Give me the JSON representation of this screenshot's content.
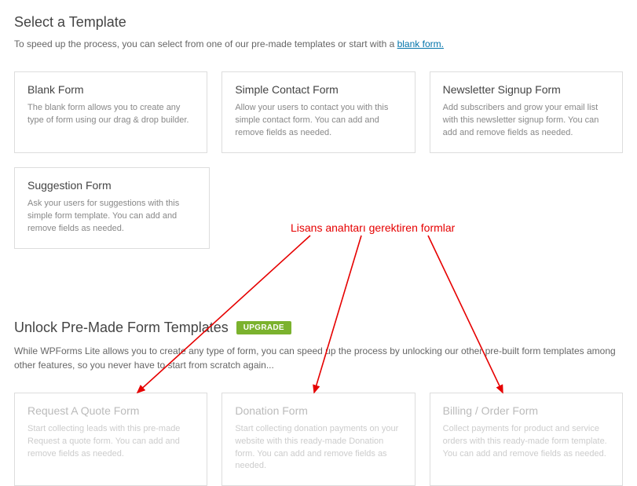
{
  "header": {
    "title": "Select a Template",
    "desc_prefix": "To speed up the process, you can select from one of our pre-made templates or start with a ",
    "blank_link": "blank form."
  },
  "templates": {
    "free": [
      {
        "title": "Blank Form",
        "desc": "The blank form allows you to create any type of form using our drag & drop builder."
      },
      {
        "title": "Simple Contact Form",
        "desc": "Allow your users to contact you with this simple contact form. You can add and remove fields as needed."
      },
      {
        "title": "Newsletter Signup Form",
        "desc": "Add subscribers and grow your email list with this newsletter signup form. You can add and remove fields as needed."
      },
      {
        "title": "Suggestion Form",
        "desc": "Ask your users for suggestions with this simple form template. You can add and remove fields as needed."
      }
    ],
    "locked": [
      {
        "title": "Request A Quote Form",
        "desc": "Start collecting leads with this pre-made Request a quote form. You can add and remove fields as needed."
      },
      {
        "title": "Donation Form",
        "desc": "Start collecting donation payments on your website with this ready-made Donation form. You can add and remove fields as needed."
      },
      {
        "title": "Billing / Order Form",
        "desc": "Collect payments for product and service orders with this ready-made form template. You can add and remove fields as needed."
      }
    ]
  },
  "unlock": {
    "title": "Unlock Pre-Made Form Templates",
    "badge": "UPGRADE",
    "desc": "While WPForms Lite allows you to create any type of form, you can speed up the process by unlocking our other pre-built form templates among other features, so you never have to start from scratch again..."
  },
  "annotation": {
    "text": "Lisans anahtarı gerektiren formlar"
  }
}
